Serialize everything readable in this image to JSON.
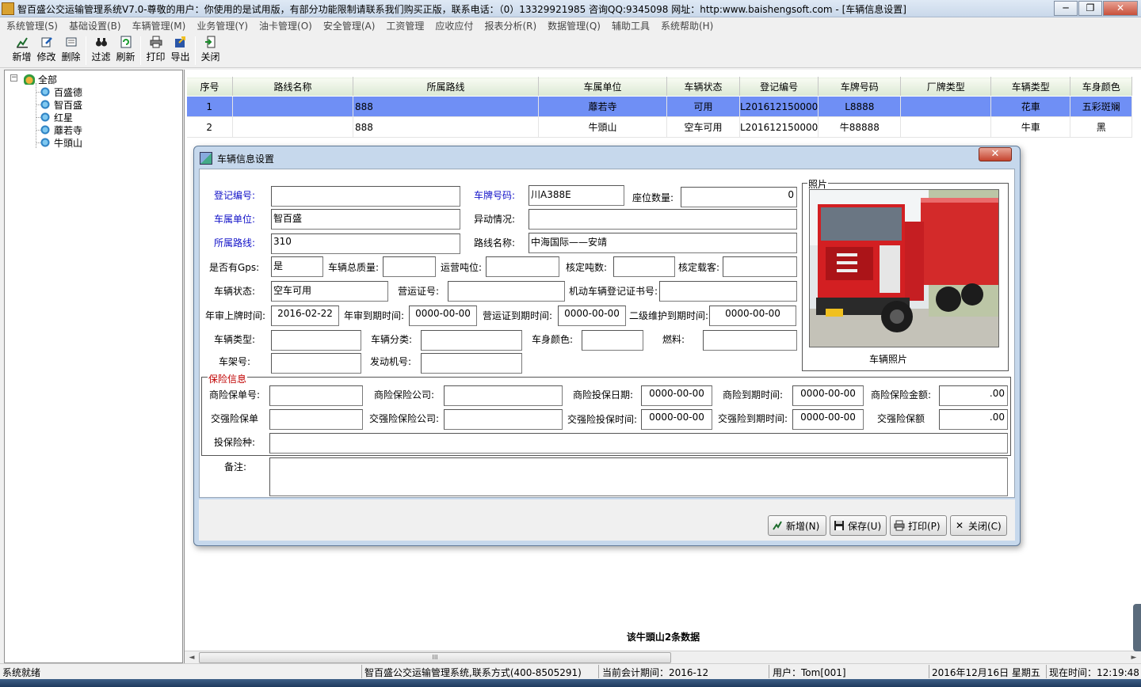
{
  "window": {
    "title": "智百盛公交运输管理系统V7.0-尊敬的用户：你使用的是试用版，有部分功能限制请联系我们购买正版，联系电话：（0）13329921985 咨询QQ:9345098 网址：http:www.baishengsoft.com - [车辆信息设置]",
    "min": "─",
    "max": "❐",
    "close": "✕"
  },
  "menu": [
    "系统管理(S)",
    "基础设置(B)",
    "车辆管理(M)",
    "业务管理(Y)",
    "油卡管理(O)",
    "安全管理(A)",
    "工资管理",
    "应收应付",
    "报表分析(R)",
    "数据管理(Q)",
    "辅助工具",
    "系统帮助(H)"
  ],
  "toolbar": {
    "add": "新增",
    "edit": "修改",
    "delete": "删除",
    "filter": "过滤",
    "refresh": "刷新",
    "print": "打印",
    "export": "导出",
    "close": "关闭"
  },
  "tree": {
    "root": "全部",
    "items": [
      "百盛德",
      "智百盛",
      "红星",
      "蘼若寺",
      "牛頭山"
    ]
  },
  "grid": {
    "columns": [
      "序号",
      "路线名称",
      "所属路线",
      "车属单位",
      "车辆状态",
      "登记编号",
      "车牌号码",
      "厂牌类型",
      "车辆类型",
      "车身颜色"
    ],
    "rows": [
      [
        "1",
        "",
        "888",
        "蘼若寺",
        "可用",
        "L201612150000",
        "L8888",
        "",
        "花車",
        "五彩斑斓"
      ],
      [
        "2",
        "",
        "888",
        "牛頭山",
        "空车可用",
        "L201612150000",
        "牛88888",
        "",
        "牛車",
        "黑"
      ]
    ],
    "footer": "该牛頭山2条数据",
    "scroll_grip": "III",
    "scroll_left": "◄",
    "scroll_right": "►"
  },
  "status": {
    "ready": "系统就绪",
    "company": "智百盛公交运输管理系统,联系方式(400-8505291)",
    "period": "当前会计期间：2016-12",
    "user": "用户：Tom[001]",
    "date": "2016年12月16日 星期五",
    "time": "现在时间：12:19:48"
  },
  "dialog": {
    "title": "车辆信息设置",
    "close": "✕",
    "fields": {
      "reg_no_label": "登记编号:",
      "reg_no": "",
      "plate_label": "车牌号码:",
      "plate": "川A388E",
      "seats_label": "座位数量:",
      "seats": "0",
      "unit_label": "车属单位:",
      "unit": "智百盛",
      "change_label": "异动情况:",
      "change": "",
      "route_label": "所属路线:",
      "route": "310",
      "route_name_label": "路线名称:",
      "route_name": "中海国际——安靖",
      "gps_label": "是否有Gps:",
      "gps": "是",
      "total_mass_label": "车辆总质量:",
      "total_mass": "",
      "op_tonnage_label": "运营吨位:",
      "op_tonnage": "",
      "rated_tonnage_label": "核定吨数:",
      "rated_tonnage": "",
      "rated_pass_label": "核定载客:",
      "rated_pass": "",
      "status_label": "车辆状态:",
      "status": "空车可用",
      "op_cert_label": "营运证号:",
      "op_cert": "",
      "motor_reg_label": "机动车辆登记证书号:",
      "motor_reg": "",
      "plate_date_label": "年审上牌时间:",
      "plate_date": "2016-02-22",
      "annual_due_label": "年审到期时间:",
      "annual_due": "0000-00-00",
      "op_cert_due_label": "营运证到期时间:",
      "op_cert_due": "0000-00-00",
      "maint_due_label": "二级维护到期时间:",
      "maint_due": "0000-00-00",
      "vehicle_type_label": "车辆类型:",
      "vehicle_type": "",
      "vehicle_class_label": "车辆分类:",
      "vehicle_class": "",
      "body_color_label": "车身颜色:",
      "body_color": "",
      "fuel_label": "燃料:",
      "fuel": "",
      "frame_no_label": "车架号:",
      "frame_no": "",
      "engine_no_label": "发动机号:",
      "engine_no": ""
    },
    "photo_group": "照片",
    "photo_caption": "车辆照片",
    "insurance": {
      "group": "保险信息",
      "com_policy_label": "商险保单号:",
      "com_policy": "",
      "com_company_label": "商险保险公司:",
      "com_company": "",
      "com_date_label": "商险投保日期:",
      "com_date": "0000-00-00",
      "com_due_label": "商险到期时间:",
      "com_due": "0000-00-00",
      "com_amount_label": "商险保险金额:",
      "com_amount": ".00",
      "cmp_policy_label": "交强险保单",
      "cmp_policy": "",
      "cmp_company_label": "交强险保险公司:",
      "cmp_company": "",
      "cmp_date_label": "交强险投保时间:",
      "cmp_date": "0000-00-00",
      "cmp_due_label": "交强险到期时间:",
      "cmp_due": "0000-00-00",
      "cmp_amount_label": "交强险保额",
      "cmp_amount": ".00",
      "types_label": "投保险种:",
      "types": ""
    },
    "notes_label": "备注:",
    "notes": "",
    "buttons": {
      "add": "新增(N)",
      "save": "保存(U)",
      "print": "打印(P)",
      "close": "关闭(C)"
    }
  }
}
